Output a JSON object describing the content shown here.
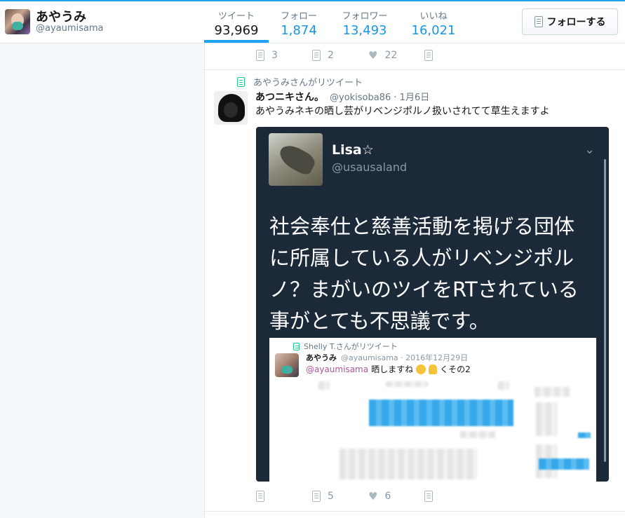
{
  "profile": {
    "name": "あやうみ",
    "handle": "@ayaumisama"
  },
  "stats": [
    {
      "label": "ツイート",
      "value": "93,969"
    },
    {
      "label": "フォロー",
      "value": "1,874"
    },
    {
      "label": "フォロワー",
      "value": "13,493"
    },
    {
      "label": "いいね",
      "value": "16,021"
    }
  ],
  "follow_button": "フォローする",
  "prev_actions": {
    "retweets": "3",
    "replies": "2",
    "likes": "22"
  },
  "tweet": {
    "retweet_by": "あやうみさんがリツイート",
    "author_name": "あつニキさん。",
    "author_meta": "@yokisoba86 · 1月6日",
    "text": "あやうみネキの晒し芸がリベンジポルノ扱いされてて草生えますよ",
    "actions": {
      "retweets": "5",
      "likes": "6"
    }
  },
  "embedded": {
    "name": "Lisa☆",
    "handle": "@usausaland",
    "body": "社会奉仕と慈善活動を掲げる団体に所属している人がリベンジポルノ？まがいのツイをRTされている事がとても不思議です。",
    "inner": {
      "retweet_by": "Shelly T.さんがリツイート",
      "name": "あやうみ",
      "meta": "@ayaumisama · 2016年12月29日",
      "mention": "@ayaumisama",
      "text_a": "晒しますね",
      "text_b": "くその2"
    }
  }
}
